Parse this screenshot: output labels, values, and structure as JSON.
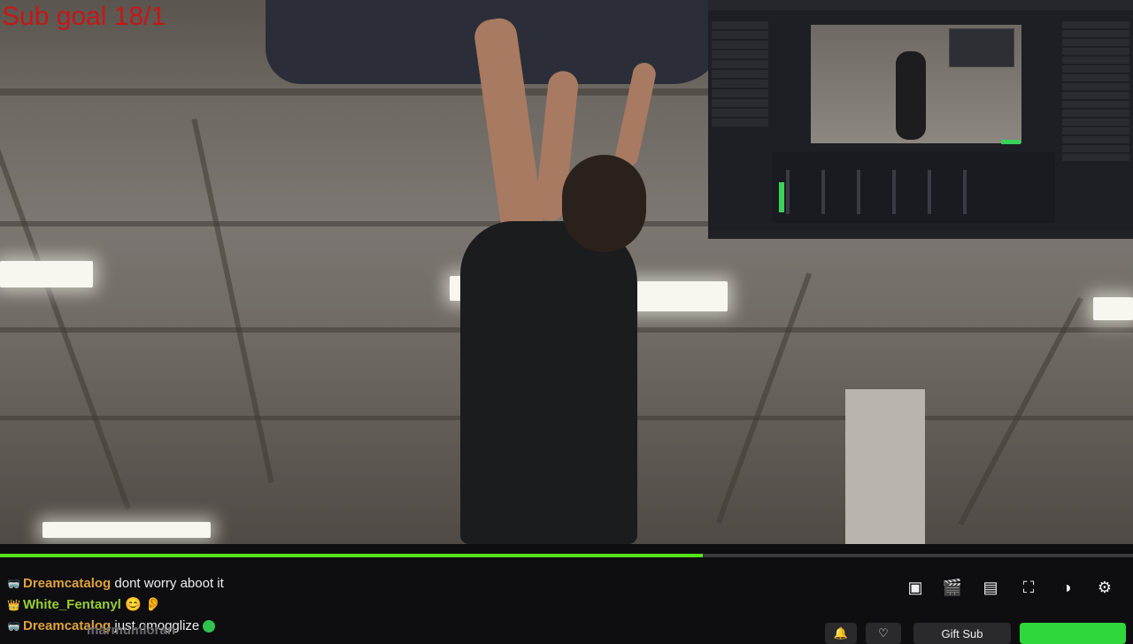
{
  "overlay": {
    "sub_goal": "Sub goal 18/1"
  },
  "video": {
    "progress": 0.62
  },
  "player_controls": [
    {
      "name": "theatre-mode-icon",
      "glyph": "▣"
    },
    {
      "name": "clip-icon",
      "glyph": "🎬"
    },
    {
      "name": "mini-player-icon",
      "glyph": "▤"
    },
    {
      "name": "fullscreen-icon",
      "glyph": "⛶"
    },
    {
      "name": "quality-icon",
      "glyph": "◑"
    },
    {
      "name": "settings-icon",
      "glyph": "⚙"
    }
  ],
  "chat": [
    {
      "badge": "🥽",
      "user": "Dreamcatalog",
      "user_class": "user-gold",
      "message": "dont worry aboot it",
      "emote": ""
    },
    {
      "badge": "👑",
      "user": "White_Fentanyl",
      "user_class": "user-green",
      "message": "",
      "emote": "😊 👂"
    },
    {
      "badge": "🥽",
      "user": "Dreamcatalog",
      "user_class": "user-gold",
      "message": "just omogglize",
      "emote": ""
    }
  ],
  "channel": {
    "name_partial": "marmumloran"
  },
  "bottom_bar": {
    "gift_label": "Gift Sub"
  },
  "colors": {
    "accent": "#57e21b",
    "goal_text": "#c41818"
  }
}
